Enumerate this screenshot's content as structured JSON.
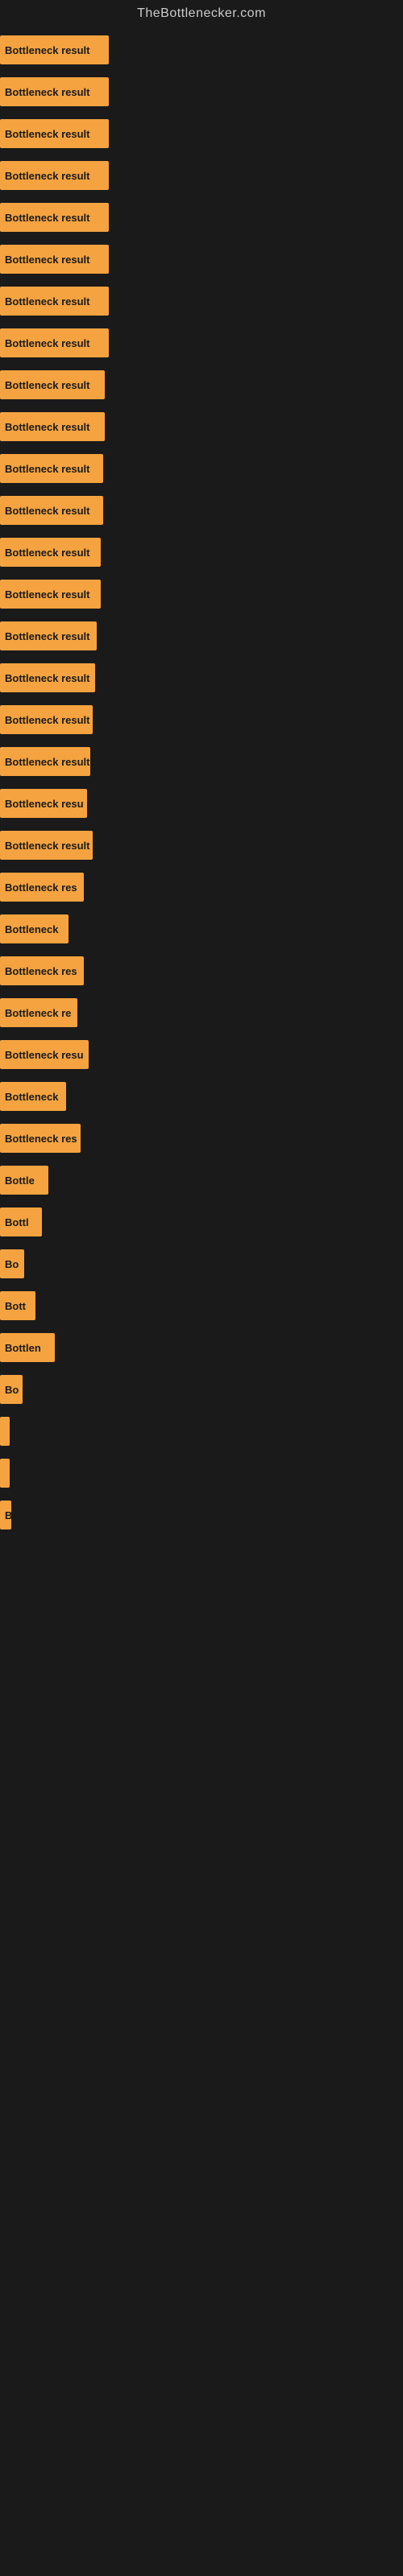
{
  "siteTitle": "TheBottlenecker.com",
  "bars": [
    {
      "label": "Bottleneck result",
      "width": 135
    },
    {
      "label": "Bottleneck result",
      "width": 135
    },
    {
      "label": "Bottleneck result",
      "width": 135
    },
    {
      "label": "Bottleneck result",
      "width": 135
    },
    {
      "label": "Bottleneck result",
      "width": 135
    },
    {
      "label": "Bottleneck result",
      "width": 135
    },
    {
      "label": "Bottleneck result",
      "width": 135
    },
    {
      "label": "Bottleneck result",
      "width": 135
    },
    {
      "label": "Bottleneck result",
      "width": 130
    },
    {
      "label": "Bottleneck result",
      "width": 130
    },
    {
      "label": "Bottleneck result",
      "width": 128
    },
    {
      "label": "Bottleneck result",
      "width": 128
    },
    {
      "label": "Bottleneck result",
      "width": 125
    },
    {
      "label": "Bottleneck result",
      "width": 125
    },
    {
      "label": "Bottleneck result",
      "width": 120
    },
    {
      "label": "Bottleneck result",
      "width": 118
    },
    {
      "label": "Bottleneck result",
      "width": 115
    },
    {
      "label": "Bottleneck result",
      "width": 112
    },
    {
      "label": "Bottleneck resu",
      "width": 108
    },
    {
      "label": "Bottleneck result",
      "width": 115
    },
    {
      "label": "Bottleneck res",
      "width": 104
    },
    {
      "label": "Bottleneck",
      "width": 85
    },
    {
      "label": "Bottleneck res",
      "width": 104
    },
    {
      "label": "Bottleneck re",
      "width": 96
    },
    {
      "label": "Bottleneck resu",
      "width": 110
    },
    {
      "label": "Bottleneck",
      "width": 82
    },
    {
      "label": "Bottleneck res",
      "width": 100
    },
    {
      "label": "Bottle",
      "width": 60
    },
    {
      "label": "Bottl",
      "width": 52
    },
    {
      "label": "Bo",
      "width": 30
    },
    {
      "label": "Bott",
      "width": 44
    },
    {
      "label": "Bottlen",
      "width": 68
    },
    {
      "label": "Bo",
      "width": 28
    },
    {
      "label": "",
      "width": 8
    },
    {
      "label": "",
      "width": 6
    },
    {
      "label": "B",
      "width": 14
    },
    {
      "label": "",
      "width": 0
    },
    {
      "label": "",
      "width": 0
    },
    {
      "label": "",
      "width": 0
    },
    {
      "label": "",
      "width": 0
    },
    {
      "label": "",
      "width": 0
    },
    {
      "label": "",
      "width": 0
    },
    {
      "label": "",
      "width": 0
    },
    {
      "label": "",
      "width": 0
    },
    {
      "label": "",
      "width": 0
    },
    {
      "label": "",
      "width": 0
    },
    {
      "label": "",
      "width": 0
    },
    {
      "label": "",
      "width": 0
    }
  ]
}
